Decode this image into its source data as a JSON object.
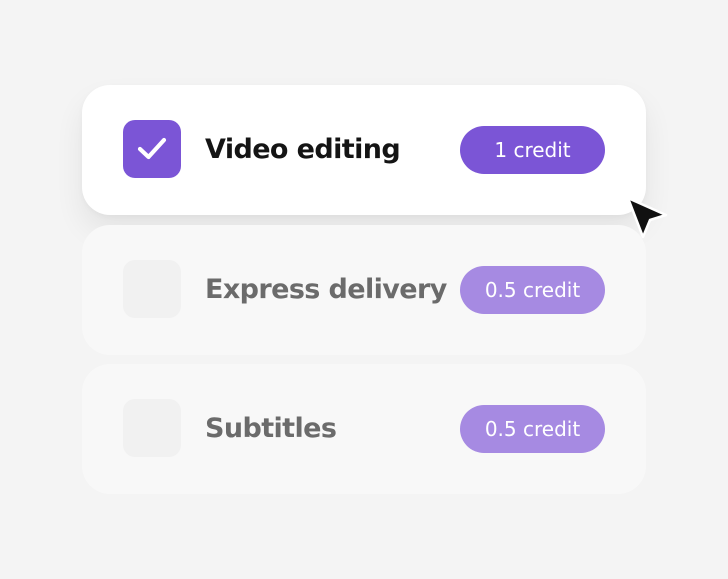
{
  "options": [
    {
      "label": "Video editing",
      "credit": "1 credit",
      "checked": true
    },
    {
      "label": "Express delivery",
      "credit": "0.5 credit",
      "checked": false
    },
    {
      "label": "Subtitles",
      "credit": "0.5 credit",
      "checked": false
    }
  ],
  "colors": {
    "accent": "#7b55d6",
    "accent_muted": "#a68ae2",
    "background": "#f4f4f4",
    "card_active": "#ffffff",
    "card_inactive": "#f8f8f8"
  },
  "icons": {
    "check": "check-icon",
    "cursor": "mouse-pointer-icon"
  }
}
